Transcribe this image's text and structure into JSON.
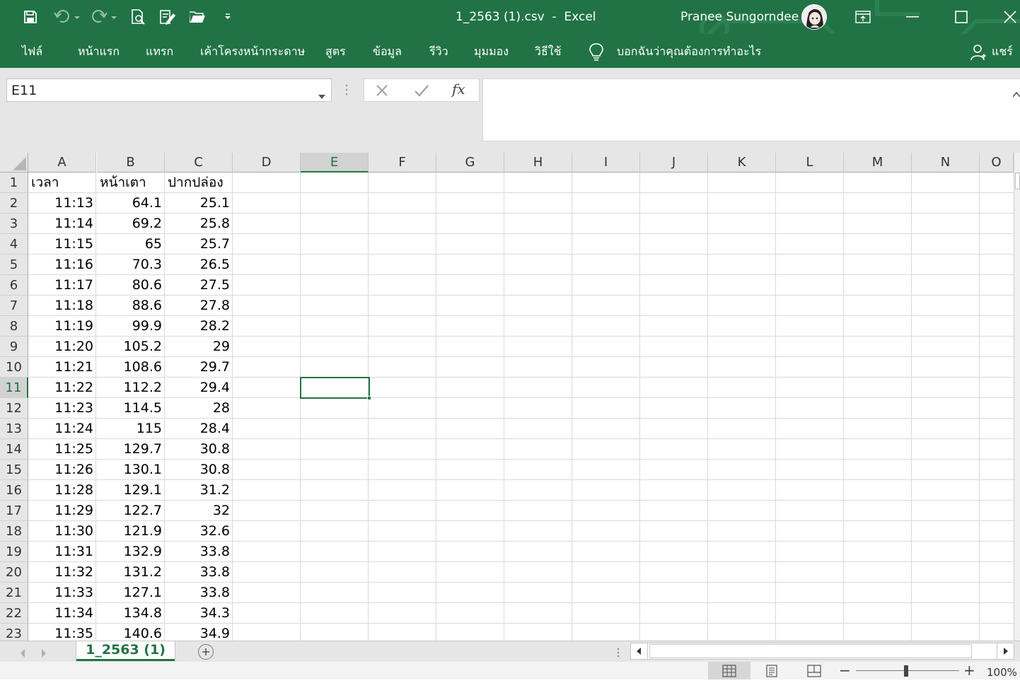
{
  "titlebar": {
    "title": "1_2563 (1).csv  -  Excel",
    "user_name": "Pranee Sungorndee"
  },
  "ribbon": {
    "tabs": [
      "ไฟล์",
      "หน้าแรก",
      "แทรก",
      "เค้าโครงหน้ากระดาษ",
      "สูตร",
      "ข้อมูล",
      "รีวิว",
      "มุมมอง",
      "วิธีใช้"
    ],
    "tell_me": "บอกฉันว่าคุณต้องการทำอะไร",
    "share": "แชร์"
  },
  "formula_bar": {
    "name_box": "E11",
    "fx": "fx",
    "formula": ""
  },
  "grid": {
    "columns": [
      "A",
      "B",
      "C",
      "D",
      "E",
      "F",
      "G",
      "H",
      "I",
      "J",
      "K",
      "L",
      "M",
      "N",
      "O"
    ],
    "selected_column": "E",
    "selected_row": 11,
    "rows": [
      {
        "n": "1",
        "a": "เวลา",
        "b": "หน้าเตา",
        "c": "ปากปล่อง"
      },
      {
        "n": "2",
        "a": "11:13",
        "b": "64.1",
        "c": "25.1"
      },
      {
        "n": "3",
        "a": "11:14",
        "b": "69.2",
        "c": "25.8"
      },
      {
        "n": "4",
        "a": "11:15",
        "b": "65",
        "c": "25.7"
      },
      {
        "n": "5",
        "a": "11:16",
        "b": "70.3",
        "c": "26.5"
      },
      {
        "n": "6",
        "a": "11:17",
        "b": "80.6",
        "c": "27.5"
      },
      {
        "n": "7",
        "a": "11:18",
        "b": "88.6",
        "c": "27.8"
      },
      {
        "n": "8",
        "a": "11:19",
        "b": "99.9",
        "c": "28.2"
      },
      {
        "n": "9",
        "a": "11:20",
        "b": "105.2",
        "c": "29"
      },
      {
        "n": "10",
        "a": "11:21",
        "b": "108.6",
        "c": "29.7"
      },
      {
        "n": "11",
        "a": "11:22",
        "b": "112.2",
        "c": "29.4"
      },
      {
        "n": "12",
        "a": "11:23",
        "b": "114.5",
        "c": "28"
      },
      {
        "n": "13",
        "a": "11:24",
        "b": "115",
        "c": "28.4"
      },
      {
        "n": "14",
        "a": "11:25",
        "b": "129.7",
        "c": "30.8"
      },
      {
        "n": "15",
        "a": "11:26",
        "b": "130.1",
        "c": "30.8"
      },
      {
        "n": "16",
        "a": "11:28",
        "b": "129.1",
        "c": "31.2"
      },
      {
        "n": "17",
        "a": "11:29",
        "b": "122.7",
        "c": "32"
      },
      {
        "n": "18",
        "a": "11:30",
        "b": "121.9",
        "c": "32.6"
      },
      {
        "n": "19",
        "a": "11:31",
        "b": "132.9",
        "c": "33.8"
      },
      {
        "n": "20",
        "a": "11:32",
        "b": "131.2",
        "c": "33.8"
      },
      {
        "n": "21",
        "a": "11:33",
        "b": "127.1",
        "c": "33.8"
      },
      {
        "n": "22",
        "a": "11:34",
        "b": "134.8",
        "c": "34.3"
      },
      {
        "n": "23",
        "a": "11:35",
        "b": "140.6",
        "c": "34.9"
      }
    ]
  },
  "sheets": {
    "active": "1_2563 (1)"
  },
  "status": {
    "zoom": "100%",
    "zoom_percent": 100
  },
  "colors": {
    "accent": "#217346",
    "ribbon_bg": "#217346",
    "header_bg": "#e6e6e6",
    "gridline": "#d9d9d9"
  }
}
